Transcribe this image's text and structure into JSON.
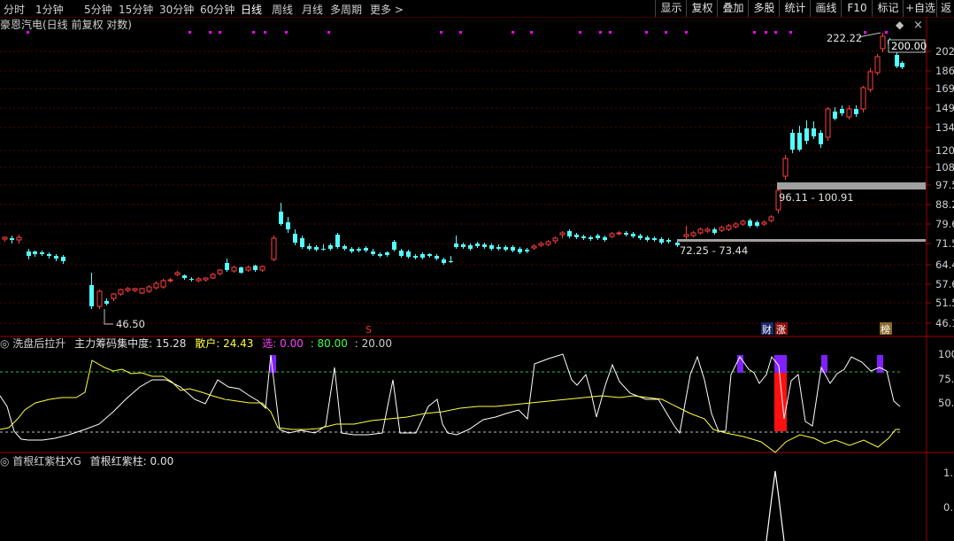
{
  "toolbar": {
    "timeframes": [
      "分时",
      "1分钟",
      "5分钟",
      "15分钟",
      "30分钟",
      "60分钟",
      "日线",
      "周线",
      "月线",
      "多周期",
      "更多 >"
    ],
    "active_timeframe": "日线",
    "right_buttons": [
      "显示",
      "复权",
      "叠加",
      "多股",
      "统计",
      "画线",
      "F10",
      "标记",
      "+自选",
      "返"
    ]
  },
  "main_panel": {
    "title": "豪恩汽电(日线 前复权 对数)",
    "price_labels": [
      "202",
      "186",
      "169",
      "149",
      "134",
      "120",
      "108",
      "97.5",
      "88.2",
      "79.6",
      "71.5",
      "64.4",
      "57.6",
      "51.5",
      "46.1"
    ],
    "annotations": {
      "high_price": "222.22",
      "current_price": "200.00",
      "zone_upper": "96.11 - 100.91",
      "zone_lower": "72.25 - 73.44",
      "low_price": "46.50"
    },
    "markers": {
      "s_marker": "S",
      "cai_marker": "财",
      "zhang_marker": "涨",
      "bang_marker": "榜"
    }
  },
  "ind1": {
    "name": "洗盘后拉升",
    "l1_label": "主力筹码集中度:",
    "l1_value": "15.28",
    "l2_label": "散户:",
    "l2_value": "24.43",
    "l3_label": "选:",
    "l3_value": "0.00",
    "l4_value": "80.00",
    "l5_value": "20.00",
    "axis": [
      "100",
      "75.",
      "50."
    ]
  },
  "ind2": {
    "name": "首根红紫柱XG",
    "l1_label": "首根红紫柱:",
    "l1_value": "0.00",
    "axis": [
      "1.",
      "0."
    ]
  },
  "colors": {
    "up": "#ff4040",
    "down": "#54ffff",
    "magenta": "#ff00ff",
    "yellow": "#ffff40",
    "purple": "#8020ff",
    "red": "#ff1010"
  }
}
